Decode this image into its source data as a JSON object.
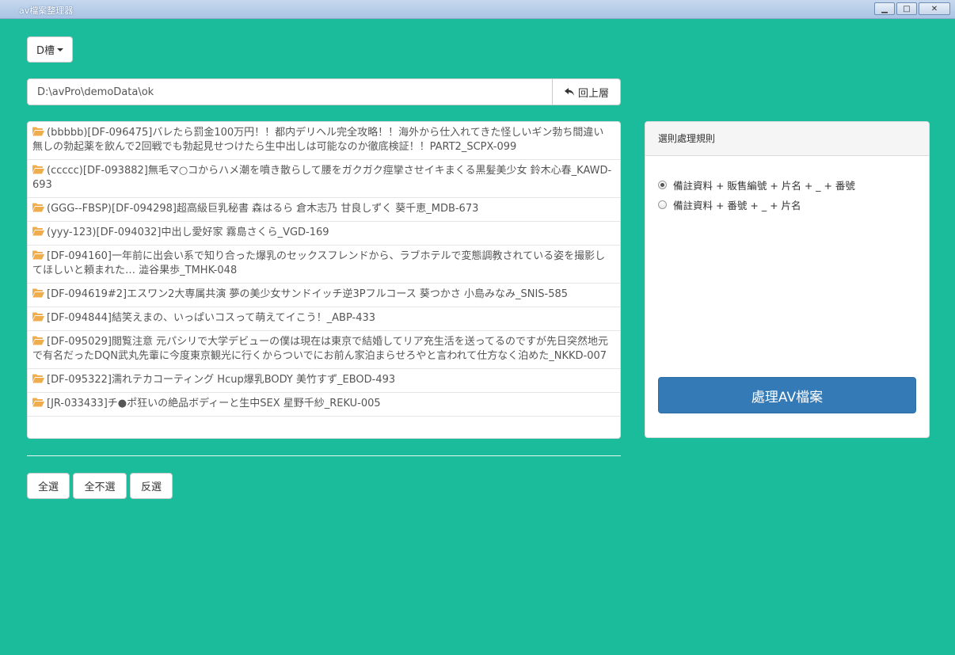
{
  "window": {
    "title": "av檔案整理器",
    "min_label": "▁",
    "max_label": "□",
    "close_label": "✕"
  },
  "drive": {
    "label": "D槽"
  },
  "path": {
    "value": "D:\\avPro\\demoData\\ok",
    "up_label": "回上層"
  },
  "files": [
    "(bbbbb)[DF-096475]バレたら罰金100万円！！都内デリヘル完全攻略！！海外から仕入れてきた怪しいギン勃ち間違い無しの勃起薬を飲んで2回戦でも勃起見せつけたら生中出しは可能なのか徹底検証！！PART2_SCPX-099",
    "(ccccc)[DF-093882]無毛マ○コからハメ潮を噴き散らして腰をガクガク痙攣させイキまくる黒髪美少女 鈴木心春_KAWD-693",
    "(GGG--FBSP)[DF-094298]超高級巨乳秘書 森はるら 倉木志乃 甘良しずく 葵千恵_MDB-673",
    "(yyy-123)[DF-094032]中出し愛好家 霧島さくら_VGD-169",
    "[DF-094160]一年前に出会い系で知り合った爆乳のセックスフレンドから、ラブホテルで変態調教されている姿を撮影してほしいと頼まれた… 澁谷果歩_TMHK-048",
    "[DF-094619#2]エスワン2大専属共演 夢の美少女サンドイッチ逆3Pフルコース 葵つかさ 小島みなみ_SNIS-585",
    "[DF-094844]結笑えまの、いっぱいコスって萌えてイこう！_ABP-433",
    "[DF-095029]閲覧注意 元パシリで大学デビューの僕は現在は東京で結婚してリア充生活を送ってるのですが先日突然地元で有名だったDQN武丸先輩に今度東京観光に行くからついでにお前ん家泊まらせろやと言われて仕方なく泊めた_NKKD-007",
    "[DF-095322]濡れテカコーティング Hcup爆乳BODY 美竹すず_EBOD-493",
    "[JR-033433]チ●ポ狂いの絶品ボディーと生中SEX 星野千紗_REKU-005"
  ],
  "selection": {
    "all_label": "全選",
    "none_label": "全不選",
    "invert_label": "反選"
  },
  "rules": {
    "heading": "選則處理規則",
    "options": [
      {
        "label": "備註資料 + 販售編號 + 片名 + _ + 番號",
        "checked": true
      },
      {
        "label": "備註資料 + 番號 + _ + 片名",
        "checked": false
      }
    ],
    "process_label": "處理AV檔案"
  },
  "colors": {
    "background": "#1abc9c",
    "primary": "#337ab7",
    "folder": "#f0ad4e"
  }
}
